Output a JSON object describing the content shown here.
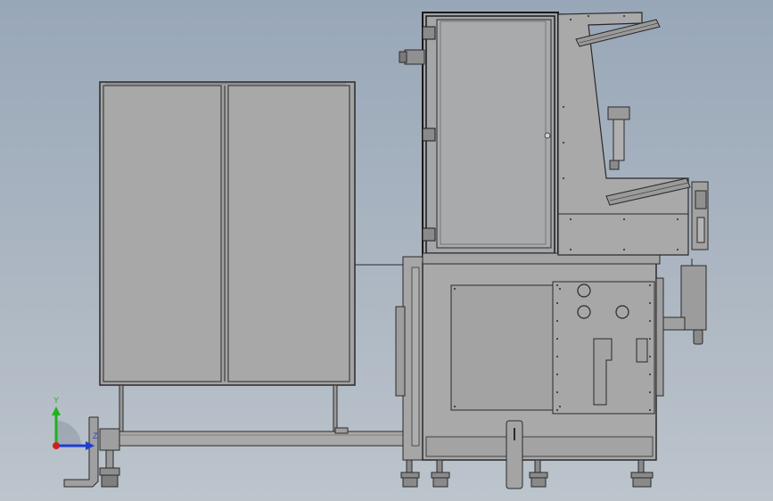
{
  "colors": {
    "background_top": "#98a7b8",
    "background_bottom": "#bcc4cc",
    "panel_fill": "#a6a6a6",
    "panel_dark": "#8f8f8f",
    "edge": "#2a2a2a",
    "axis_x": "#d11f1f",
    "axis_y": "#1fb11f",
    "axis_z": "#1f3fd1"
  },
  "triad": {
    "y_label": "Y",
    "z_label": "Z"
  }
}
